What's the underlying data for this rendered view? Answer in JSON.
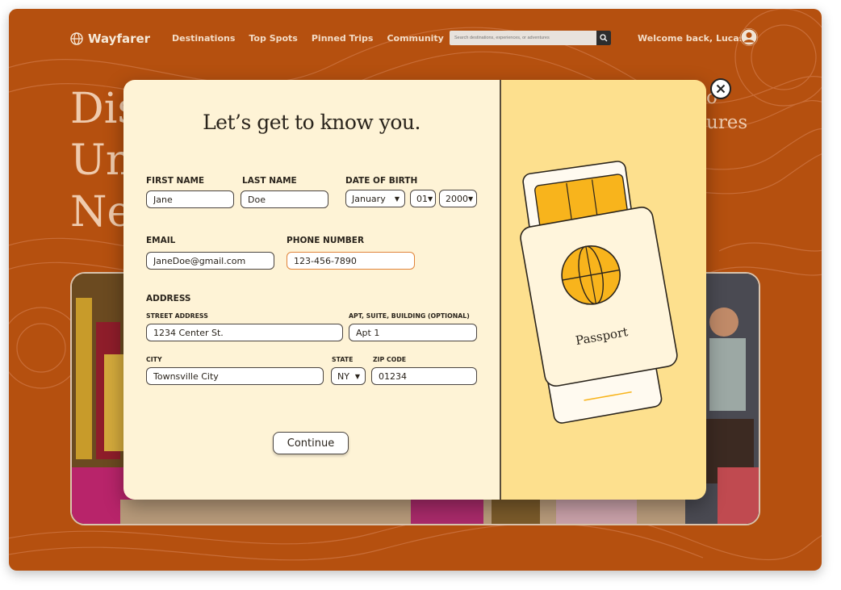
{
  "brand": {
    "name": "Wayfarer",
    "accent": "#b5500f"
  },
  "nav": {
    "links": [
      "Destinations",
      "Top Spots",
      "Pinned Trips",
      "Community"
    ],
    "search_placeholder": "Search destinations, experiences, or adventures",
    "welcome": "Welcome back, Lucas"
  },
  "hero": {
    "line1": "Dis",
    "line2": "Un",
    "line3": "Ne",
    "right_line1": "o",
    "right_line2": "ures"
  },
  "modal": {
    "title": "Let’s get to know you.",
    "labels": {
      "first_name": "FIRST NAME",
      "last_name": "LAST NAME",
      "dob": "DATE OF BIRTH",
      "email": "EMAIL",
      "phone": "PHONE NUMBER",
      "address": "ADDRESS",
      "street": "STREET ADDRESS",
      "apt": "APT, SUITE, BUILDING (OPTIONAL)",
      "city": "CITY",
      "state": "STATE",
      "zip": "ZIP CODE"
    },
    "values": {
      "first_name": "Jane",
      "last_name": "Doe",
      "dob_month": "January",
      "dob_day": "01",
      "dob_year": "2000",
      "email": "JaneDoe@gmail.com",
      "phone": "123-456-7890",
      "street": "1234 Center St.",
      "apt": "Apt 1",
      "city": "Townsville City",
      "state": "NY",
      "zip": "01234"
    },
    "continue_label": "Continue",
    "passport_label": "Passport"
  },
  "colors": {
    "modal_left": "#fef3d6",
    "modal_right": "#fde08e",
    "focus_border": "#e0843a",
    "passport_gold": "#f8b41c"
  }
}
